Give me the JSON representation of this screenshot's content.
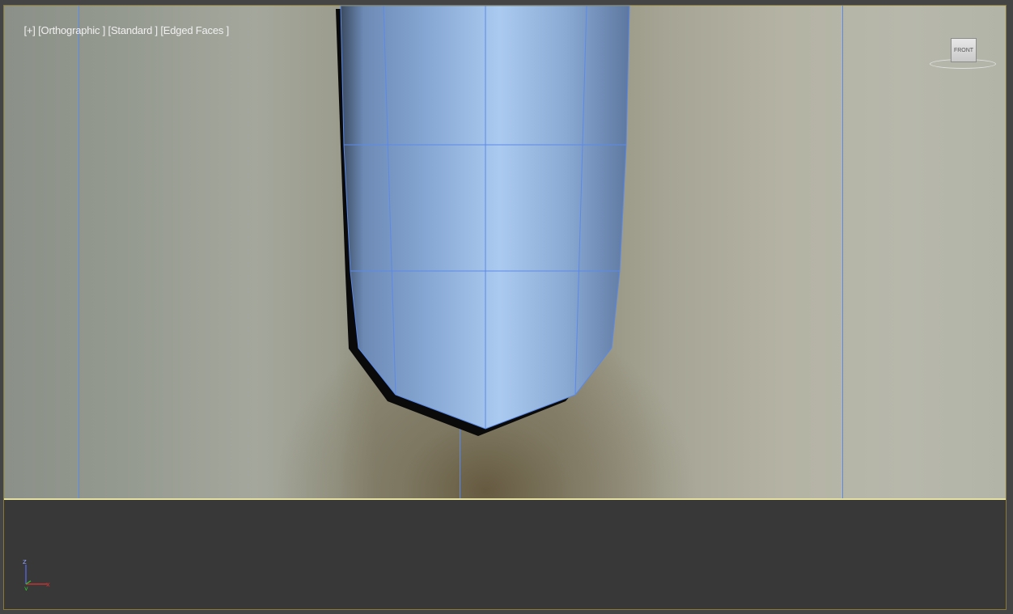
{
  "viewport": {
    "label_plus": "[+]",
    "label_view": "[Orthographic ]",
    "label_shading": "[Standard ]",
    "label_edges": "[Edged Faces ]"
  },
  "viewcube": {
    "face_label": "FRONT"
  },
  "axis_gizmo": {
    "z_label": "z",
    "y_label": "y",
    "x_label": "x"
  },
  "colors": {
    "wireframe": "#5b8ae8",
    "model_fill": "#9bbde6",
    "active_border": "#e6e1a0",
    "axis_z": "#5b6cf0",
    "axis_x": "#e03030",
    "axis_y": "#30c030"
  }
}
